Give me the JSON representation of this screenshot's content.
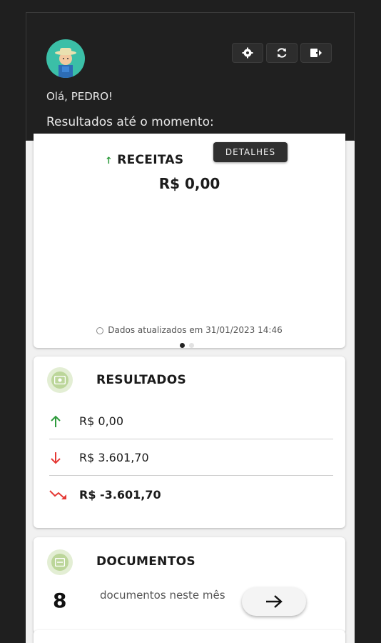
{
  "header": {
    "greeting": "Olá, PEDRO!",
    "subtitle": "Resultados até o momento:",
    "icons": [
      "settings-icon",
      "refresh-icon",
      "logout-icon"
    ]
  },
  "receitas": {
    "title": "RECEITAS",
    "details_button": "DETALHES",
    "value": "R$ 0,00",
    "updated": "Dados atualizados em 31/01/2023 14:46",
    "pager": {
      "count": 2,
      "active_index": 0
    }
  },
  "resultados": {
    "title": "RESULTADOS",
    "rows": [
      {
        "icon": "arrow-up-icon",
        "value": "R$ 0,00"
      },
      {
        "icon": "arrow-down-icon",
        "value": "R$ 3.601,70"
      },
      {
        "icon": "trend-down-icon",
        "value": "R$ -3.601,70"
      }
    ]
  },
  "documentos": {
    "title": "DOCUMENTOS",
    "count": "8",
    "label": "documentos neste mês"
  },
  "colors": {
    "background": "#1f1f1f",
    "header": "#202020",
    "positive": "#2e9b3c",
    "negative": "#e53935",
    "avatar": "#3bbfa7",
    "section_icon": "#bcd69a"
  }
}
